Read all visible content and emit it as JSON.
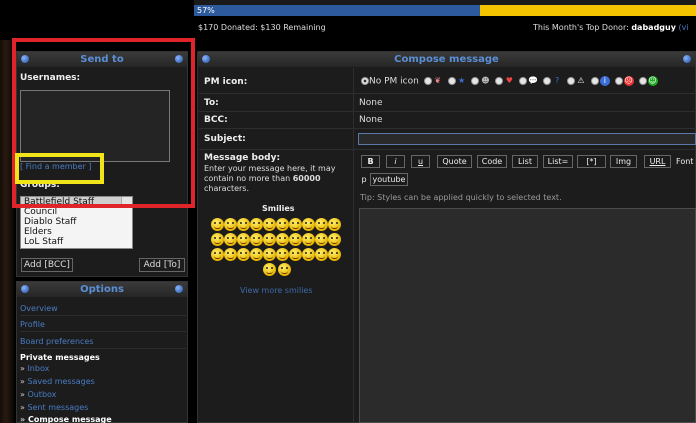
{
  "donation": {
    "percent_label": "57%",
    "progress_fraction": 0.57,
    "donated_text": "$170 Donated: $130 Remaining",
    "top_donor_prefix": "This Month's Top Donor:",
    "top_donor_name": "dabadguy",
    "top_donor_suffix": "(vi"
  },
  "sendto": {
    "title": "Send to",
    "usernames_label": "Usernames:",
    "find_member": "[ Find a member ]",
    "groups_label": "Groups:",
    "groups": [
      "Battlefield Staff",
      "Council",
      "Diablo Staff",
      "Elders",
      "LoL Staff"
    ],
    "add_bcc": "Add [BCC]",
    "add_to": "Add [To]"
  },
  "options": {
    "title": "Options",
    "links": [
      "Overview",
      "Profile",
      "Board preferences"
    ],
    "private_messages_heading": "Private messages",
    "pm_links": [
      "Inbox",
      "Saved messages",
      "Outbox",
      "Sent messages",
      "Compose message"
    ],
    "active_item": "Compose message"
  },
  "compose": {
    "title": "Compose message",
    "pm_icon_label": "PM icon:",
    "no_pm_icon": "No PM icon",
    "to_label": "To:",
    "to_value": "None",
    "bcc_label": "BCC:",
    "bcc_value": "None",
    "subject_label": "Subject:",
    "subject_value": "",
    "body_label": "Message body:",
    "body_desc_1": "Enter your message here, it may contain no more than ",
    "body_limit": "60000",
    "body_desc_2": " characters.",
    "buttons": [
      "B",
      "i",
      "u",
      "Quote",
      "Code",
      "List",
      "List=",
      "[*]",
      "Img",
      "URL"
    ],
    "font_label": "Font",
    "p_label": "p",
    "youtube_button": "youtube",
    "tip": "Tip: Styles can be applied quickly to selected text.",
    "smilies_title": "Smilies",
    "view_more_smilies": "View more smilies",
    "smiley_count": 32,
    "icon_colors": [
      "#e88",
      "#3a6fd8",
      "#bbb",
      "#e44",
      "#bbb",
      "#3a6fd8",
      "#eee",
      "#eb0",
      "#3a6fd8",
      "#e33",
      "#2a2"
    ]
  },
  "colors": {
    "highlight_red": "#e0252a",
    "highlight_yellow": "#f1e51a",
    "link_blue": "#4a7cc4",
    "progress_blue": "#2c5a9c",
    "progress_yellow": "#f4c400"
  }
}
